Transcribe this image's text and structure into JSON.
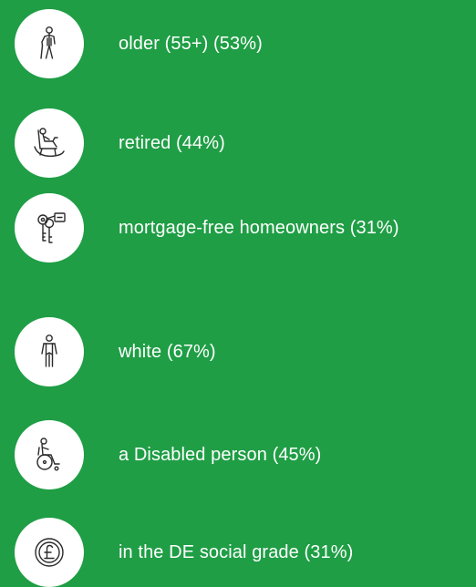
{
  "accent_color": "#1f9e45",
  "items": [
    {
      "icon": "older-person-with-cane-icon",
      "label": "older (55+) (53%)"
    },
    {
      "icon": "person-in-rocking-chair-icon",
      "label": "retired (44%)"
    },
    {
      "icon": "house-keys-icon",
      "label": "mortgage-free homeowners (31%)"
    },
    {
      "icon": "standing-person-icon",
      "label": "white (67%)"
    },
    {
      "icon": "wheelchair-user-icon",
      "label": "a Disabled person (45%)"
    },
    {
      "icon": "pound-coin-icon",
      "label": "in the DE social grade (31%)"
    }
  ]
}
